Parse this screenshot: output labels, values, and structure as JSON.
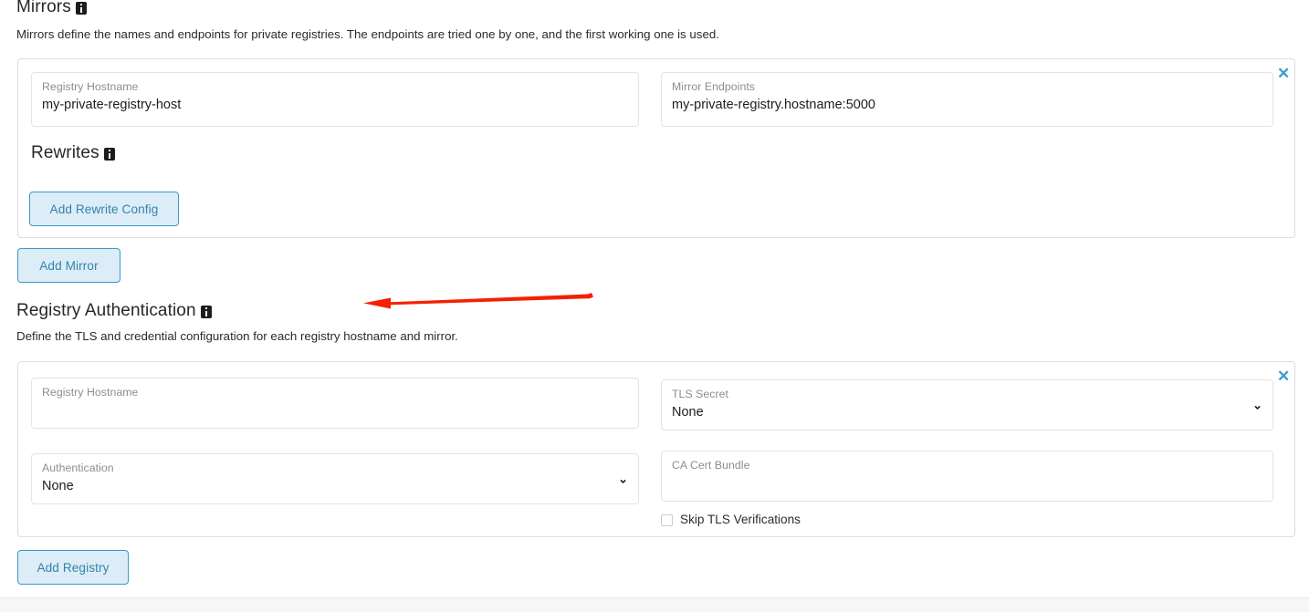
{
  "mirrors": {
    "title": "Mirrors",
    "info_icon": "info-icon",
    "description": "Mirrors define the names and endpoints for private registries. The endpoints are tried one by one, and the first working one is used.",
    "entry": {
      "registry_hostname": {
        "label": "Registry Hostname",
        "value": "my-private-registry-host",
        "placeholder": ""
      },
      "mirror_endpoints": {
        "label": "Mirror Endpoints",
        "value": "my-private-registry.hostname:5000",
        "placeholder": ""
      },
      "remove_label": "✕",
      "rewrites": {
        "title": "Rewrites",
        "info_icon": "info-icon",
        "add_button": "Add Rewrite Config"
      }
    },
    "add_button": "Add Mirror"
  },
  "registry_auth": {
    "title": "Registry Authentication",
    "info_icon": "info-icon",
    "description": "Define the TLS and credential configuration for each registry hostname and mirror.",
    "entry": {
      "registry_hostname": {
        "label": "Registry Hostname",
        "value": ""
      },
      "tls_secret": {
        "label": "TLS Secret",
        "value": "None",
        "chevron": "⌄"
      },
      "authentication": {
        "label": "Authentication",
        "value": "None",
        "chevron": "⌄"
      },
      "ca_cert_bundle": {
        "label": "CA Cert Bundle",
        "value": ""
      },
      "skip_tls": {
        "label": "Skip TLS Verifications",
        "checked": false
      },
      "remove_label": "✕"
    },
    "add_button": "Add Registry"
  },
  "annotation": {
    "arrow_color": "#f42000",
    "direction": "left"
  },
  "colors": {
    "accent_blue": "#3d98c9",
    "button_fill": "#dcedf7",
    "card_border": "#dcdce4",
    "field_border": "#e3e3e8",
    "label_gray": "#8a8d93",
    "annotation_red": "#f42000"
  }
}
